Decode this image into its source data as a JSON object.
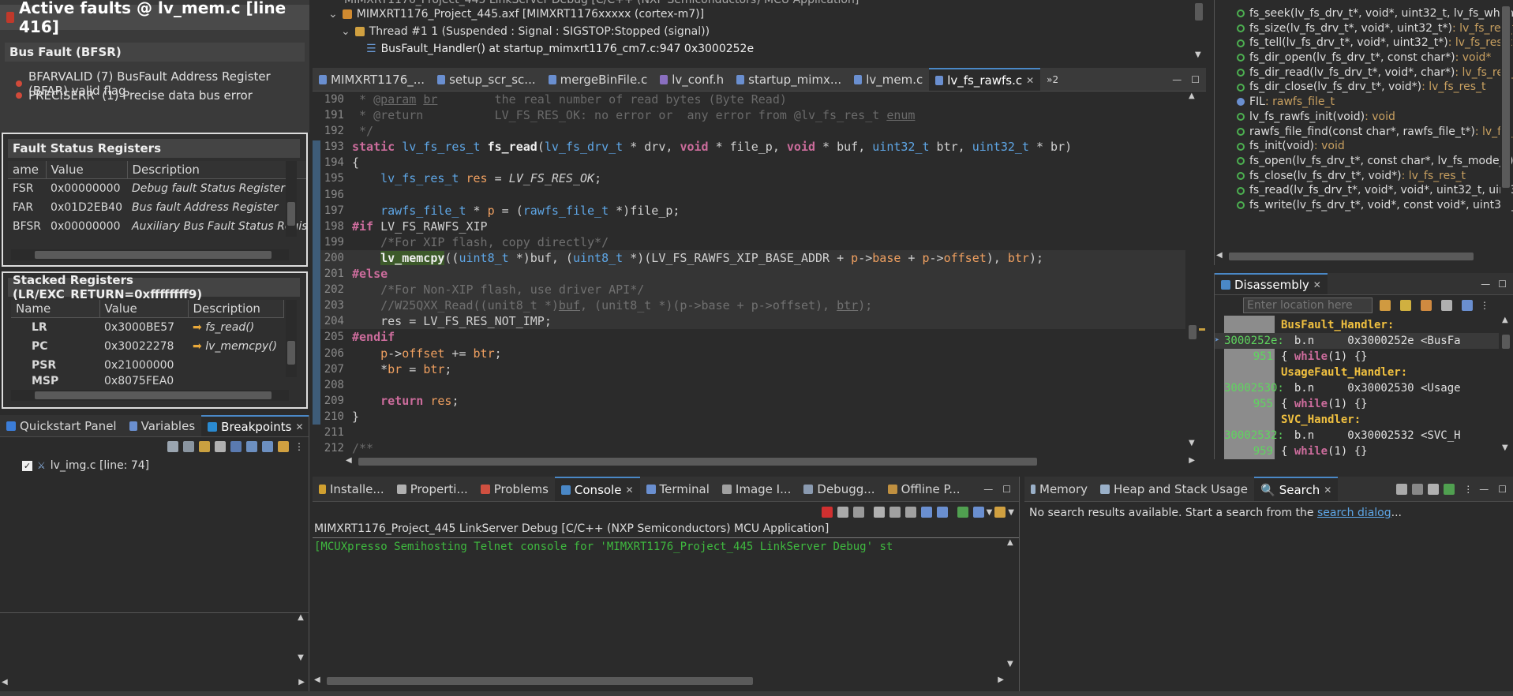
{
  "faults": {
    "title": "Active faults @ lv_mem.c [line 416]",
    "bus_fault_header": "Bus Fault (BFSR)",
    "items": [
      "BFARVALID (7) BusFault Address Register (BFAR) valid flag",
      "PRECISERR  (1) Precise data bus error"
    ]
  },
  "fault_status": {
    "title": "Fault Status Registers",
    "columns": [
      "ame",
      "Value",
      "Description"
    ],
    "rows": [
      {
        "name": "FSR",
        "value": "0x00000000",
        "desc": "Debug fault Status Register"
      },
      {
        "name": "FAR",
        "value": "0x01D2EB40",
        "desc": "Bus fault Address Register"
      },
      {
        "name": "BFSR",
        "value": "0x00000000",
        "desc": "Auxiliary Bus Fault Status Regis..."
      }
    ]
  },
  "stacked": {
    "title": "Stacked Registers (LR/EXC_RETURN=0xffffffff9)",
    "columns": [
      "Name",
      "Value",
      "Description"
    ],
    "rows": [
      {
        "name": "LR",
        "value": "0x3000BE57",
        "desc": "fs_read()"
      },
      {
        "name": "PC",
        "value": "0x30022278",
        "desc": "lv_memcpy()"
      },
      {
        "name": "PSR",
        "value": "0x21000000",
        "desc": ""
      },
      {
        "name": "MSP",
        "value": "0x8075FEA0",
        "desc": ""
      }
    ]
  },
  "left_tabs": {
    "quickstart": "Quickstart Panel",
    "variables": "Variables",
    "breakpoints": "Breakpoints"
  },
  "breakpoint_item": "lv_img.c [line: 74]",
  "debug_tree": {
    "top": "MIMXRT1176_Project_445 LinkServer Debug [C/C++ (NXP Semiconductors) MCU Application]",
    "axf": "MIMXRT1176_Project_445.axf [MIMXRT1176xxxxx (cortex-m7)]",
    "thread": "Thread #1 1 (Suspended : Signal : SIGSTOP:Stopped (signal))",
    "frame": "BusFault_Handler() at startup_mimxrt1176_cm7.c:947 0x3000252e"
  },
  "editor_tabs": [
    "MIMXRT1176_...",
    "setup_scr_sc...",
    "mergeBinFile.c",
    "lv_conf.h",
    "startup_mimx...",
    "lv_mem.c",
    "lv_fs_rawfs.c",
    "»2"
  ],
  "code": [
    {
      "n": "190",
      "html": "<span class='doc'> * @<u>param</u> <u>br</u>        the real number of read bytes (Byte Read)</span>"
    },
    {
      "n": "191",
      "html": "<span class='doc'> * @return          LV_FS_RES_OK: no error or  any error from @lv_fs_res_t <u>enum</u></span>"
    },
    {
      "n": "192",
      "html": "<span class='doc'> */</span>"
    },
    {
      "n": "193",
      "html": "<span class='kw'>static</span> <span class='ty'>lv_fs_res_t</span> <span class='fn'>fs_read</span>(<span class='ty'>lv_fs_drv_t</span> * drv, <span class='kw'>void</span> * file_p, <span class='kw'>void</span> * buf, <span class='ty'>uint32_t</span> btr, <span class='ty'>uint32_t</span> * br)"
    },
    {
      "n": "194",
      "html": "{"
    },
    {
      "n": "195",
      "html": "    <span class='ty'>lv_fs_res_t</span> <span class='var'>res</span> = <span class='it'>LV_FS_RES_OK</span>;"
    },
    {
      "n": "196",
      "html": ""
    },
    {
      "n": "197",
      "html": "    <span class='ty'>rawfs_file_t</span> * <span class='var'>p</span> = (<span class='ty'>rawfs_file_t</span> *)file_p;"
    },
    {
      "n": "198",
      "html": "<span class='pp'>#if</span> LV_FS_RAWFS_XIP"
    },
    {
      "n": "199",
      "html": "    <span class='cm'>/*For XIP flash, copy directly*/</span>"
    },
    {
      "n": "200",
      "html": "    <span class='fn' style='background:#3d5a2a'>lv_memcpy</span>((<span class='ty'>uint8_t</span> *)buf, (<span class='ty'>uint8_t</span> *)(LV_FS_RAWFS_XIP_BASE_ADDR + <span class='var'>p</span>-><span class='var'>base</span> + <span class='var'>p</span>-><span class='var'>offset</span>), <span class='var'>btr</span>);"
    },
    {
      "n": "201",
      "html": "<span class='pp'>#else</span>"
    },
    {
      "n": "202",
      "html": "    <span class='cm'>/*For Non-XIP flash, use driver API*/</span>"
    },
    {
      "n": "203",
      "html": "    <span class='cm'>//W25QXX_Read((unit8_t *)<u>buf</u>, (unit8_t *)(p->base + p->offset), <u>btr</u>);</span>"
    },
    {
      "n": "204",
      "html": "    res = LV_FS_RES_NOT_IMP;"
    },
    {
      "n": "205",
      "html": "<span class='pp'>#endif</span>"
    },
    {
      "n": "206",
      "html": "    <span class='var'>p</span>-><span class='var'>offset</span> += <span class='var'>btr</span>;"
    },
    {
      "n": "207",
      "html": "    *<span class='var'>br</span> = <span class='var'>btr</span>;"
    },
    {
      "n": "208",
      "html": ""
    },
    {
      "n": "209",
      "html": "    <span class='kw'>return</span> <span class='var'>res</span>;"
    },
    {
      "n": "210",
      "html": "}"
    },
    {
      "n": "211",
      "html": ""
    },
    {
      "n": "212",
      "html": "<span class='doc'>/**</span>"
    }
  ],
  "outline": [
    {
      "sig": "fs_seek(lv_fs_drv_t*, void*, uint32_t, lv_fs_whenc",
      "ret": "",
      "kind": "open"
    },
    {
      "sig": "fs_size(lv_fs_drv_t*, void*, uint32_t*)",
      "ret": " : lv_fs_res_t",
      "kind": "open"
    },
    {
      "sig": "fs_tell(lv_fs_drv_t*, void*, uint32_t*)",
      "ret": " : lv_fs_res_t",
      "kind": "open"
    },
    {
      "sig": "fs_dir_open(lv_fs_drv_t*, const char*)",
      "ret": " : void*",
      "kind": "open"
    },
    {
      "sig": "fs_dir_read(lv_fs_drv_t*, void*, char*)",
      "ret": " : lv_fs_res_",
      "kind": "open"
    },
    {
      "sig": "fs_dir_close(lv_fs_drv_t*, void*)",
      "ret": " : lv_fs_res_t",
      "kind": "open"
    },
    {
      "sig": "FIL",
      "ret": " : rawfs_file_t",
      "kind": "var"
    },
    {
      "sig": "lv_fs_rawfs_init(void)",
      "ret": " : void",
      "kind": "pub"
    },
    {
      "sig": "rawfs_file_find(const char*, rawfs_file_t*)",
      "ret": " : lv_fs_",
      "kind": "open"
    },
    {
      "sig": "fs_init(void)",
      "ret": " : void",
      "kind": "open"
    },
    {
      "sig": "fs_open(lv_fs_drv_t*, const char*, lv_fs_mode_t)",
      "ret": " : ",
      "kind": "open"
    },
    {
      "sig": "fs_close(lv_fs_drv_t*, void*)",
      "ret": " : lv_fs_res_t",
      "kind": "open"
    },
    {
      "sig": "fs_read(lv_fs_drv_t*, void*, void*, uint32_t, uint3",
      "ret": "",
      "kind": "open"
    },
    {
      "sig": "fs_write(lv_fs_drv_t*, void*, const void*, uint32_t",
      "ret": "",
      "kind": "open"
    }
  ],
  "disassembly": {
    "tab": "Disassembly",
    "location_placeholder": "Enter location here",
    "rows": [
      {
        "addr": "",
        "text": "BusFault_Handler:",
        "type": "label"
      },
      {
        "addr": "3000252e:",
        "text": "  b.n     0x3000252e <BusFa",
        "type": "instr",
        "current": true
      },
      {
        "addr": "951",
        "text": "{ while(1) {}",
        "type": "src"
      },
      {
        "addr": "",
        "text": "UsageFault_Handler:",
        "type": "label"
      },
      {
        "addr": "30002530:",
        "text": "  b.n     0x30002530 <Usage",
        "type": "instr"
      },
      {
        "addr": "955",
        "text": "{ while(1) {}",
        "type": "src"
      },
      {
        "addr": "",
        "text": "SVC_Handler:",
        "type": "label"
      },
      {
        "addr": "30002532:",
        "text": "  b.n     0x30002532 <SVC_H",
        "type": "instr"
      },
      {
        "addr": "959",
        "text": "{ while(1) {}",
        "type": "src"
      }
    ]
  },
  "bottom_tabs": [
    "Installe...",
    "Properti...",
    "Problems",
    "Console",
    "Terminal",
    "Image I...",
    "Debugg...",
    "Offline P..."
  ],
  "console": {
    "title": "MIMXRT1176_Project_445 LinkServer Debug [C/C++ (NXP Semiconductors) MCU Application]",
    "line": "[MCUXpresso Semihosting Telnet console for 'MIMXRT1176_Project_445 LinkServer Debug' st"
  },
  "right_bottom_tabs": [
    "Memory",
    "Heap and Stack Usage",
    "Search"
  ],
  "search": {
    "text": "No search results available. Start a search from the ",
    "link": "search dialog",
    "suffix": "..."
  }
}
